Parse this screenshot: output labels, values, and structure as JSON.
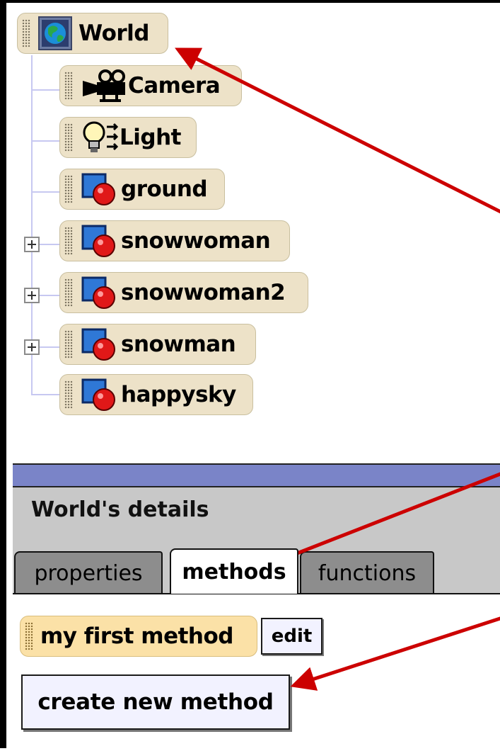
{
  "tree": {
    "items": [
      {
        "label": "World",
        "icon": "globe-icon",
        "expandable": false
      },
      {
        "label": "Camera",
        "icon": "movie-camera-icon",
        "expandable": false
      },
      {
        "label": "Light",
        "icon": "light-bulb-icon",
        "expandable": false
      },
      {
        "label": "ground",
        "icon": "object-icon",
        "expandable": false
      },
      {
        "label": "snowwoman",
        "icon": "object-icon",
        "expandable": true
      },
      {
        "label": "snowwoman2",
        "icon": "object-icon",
        "expandable": true
      },
      {
        "label": "snowman",
        "icon": "object-icon",
        "expandable": true
      },
      {
        "label": "happysky",
        "icon": "object-icon",
        "expandable": false
      }
    ]
  },
  "details": {
    "title": "World's details",
    "tabs": [
      {
        "label": "properties",
        "active": false
      },
      {
        "label": "methods",
        "active": true
      },
      {
        "label": "functions",
        "active": false
      }
    ]
  },
  "methods": {
    "method_name": "my first method",
    "edit_label": "edit",
    "create_label": "create new method"
  },
  "colors": {
    "tile_bg": "#ede2c8",
    "method_tile_bg": "#fbe1a7",
    "divider": "#7a84c8",
    "details_bg": "#c8c8c8",
    "annotation_arrow": "#cc0000"
  }
}
